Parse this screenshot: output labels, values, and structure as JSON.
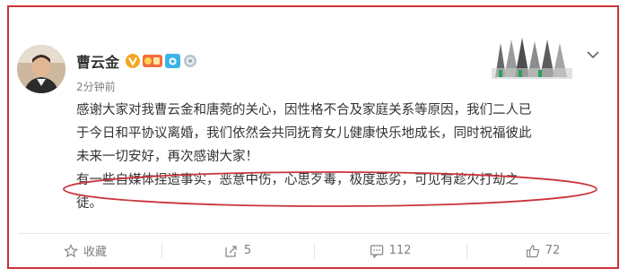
{
  "post": {
    "author": "曹云金",
    "timestamp": "2分钟前",
    "lines": [
      "感谢大家对我曹云金和唐菀的关心，因性格不合及家庭关系等原因，我们二人已",
      "于今日和平协议离婚，我们依然会共同抚育女儿健康快乐地成长，同时祝福彼此",
      "未来一切安好，再次感谢大家！",
      "有一些自媒体捏造事实，恶意中伤，心思歹毒，极度恶劣，可见有趁火打劫之",
      "徒。"
    ]
  },
  "badges": [
    "verified-v-icon",
    "vip-icon",
    "camera-badge-icon",
    "medal-icon"
  ],
  "actions": {
    "favorite_label": "收藏",
    "repost_count": "5",
    "comment_count": "112",
    "like_count": "72"
  },
  "colors": {
    "annotation_red": "#c9343a",
    "verified_orange": "#f5a623",
    "text": "#333333",
    "muted": "#808080"
  }
}
